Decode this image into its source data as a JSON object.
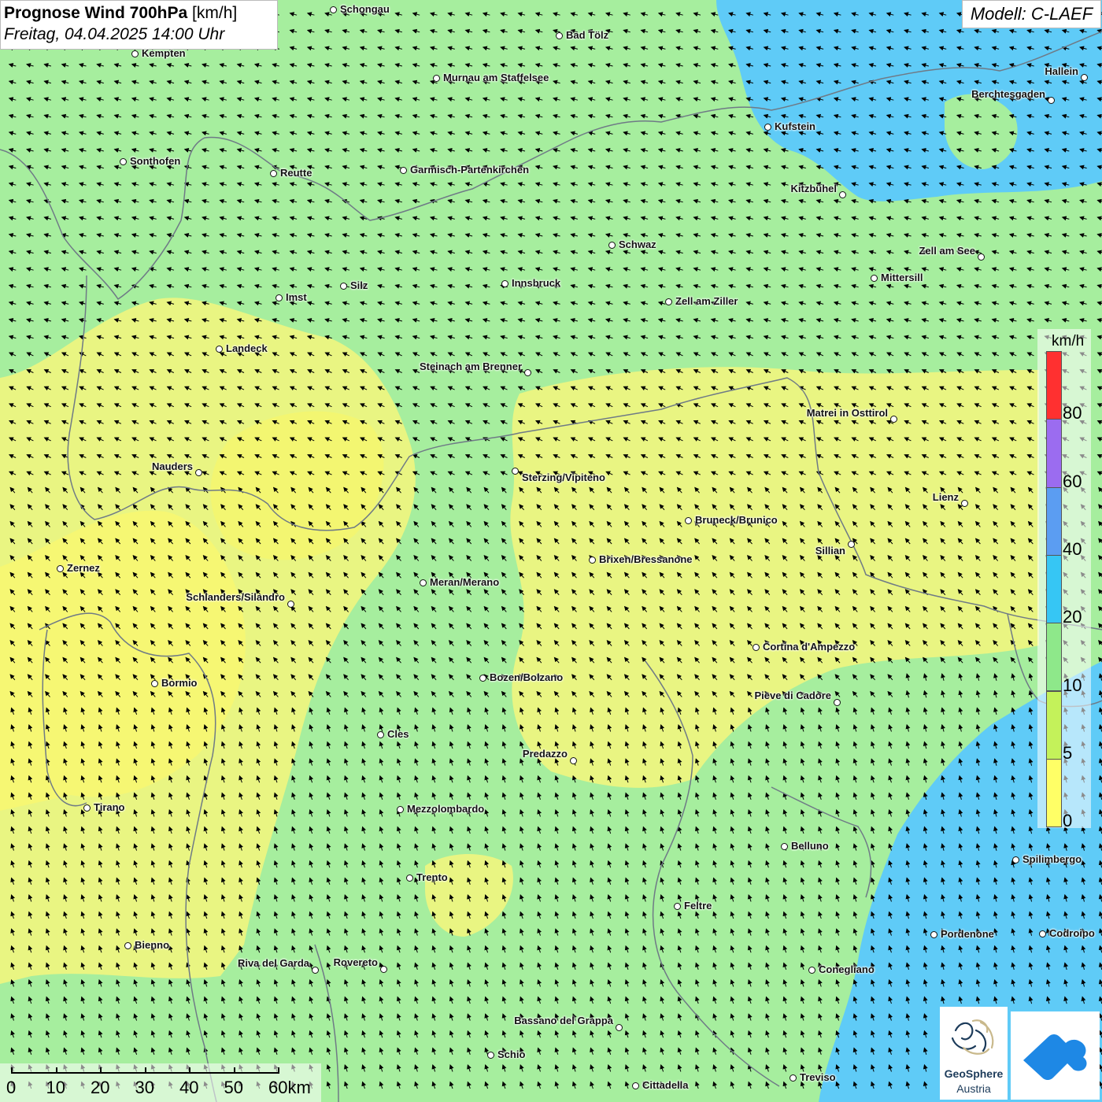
{
  "title": {
    "main": "Prognose Wind 700hPa",
    "unit": "[km/h]",
    "datetime": "Freitag, 04.04.2025 14:00 Uhr"
  },
  "model_label": "Modell: C-LAEF",
  "legend": {
    "unit": "km/h",
    "ticks": [
      "80",
      "60",
      "40",
      "20",
      "10",
      "5",
      "0"
    ],
    "colors": [
      "#ff3030",
      "#9b6cf0",
      "#5b9df2",
      "#36c6f4",
      "#8ee88a",
      "#c4f25a",
      "#ffff66"
    ]
  },
  "scale_bar": {
    "labels": [
      "0",
      "10",
      "20",
      "30",
      "40",
      "50",
      "60km"
    ]
  },
  "logos": {
    "geosphere_line1": "GeoSphere",
    "geosphere_line2": "Austria"
  },
  "colors": {
    "green": "#a6ee9e",
    "yellow": "#ecf582",
    "light_yellow": "#f6f773",
    "blue": "#5fcbf7",
    "border": "#6f7a86"
  },
  "cities": [
    {
      "name": "Schongau"
    },
    {
      "name": "Bad Tölz"
    },
    {
      "name": "Kempten"
    },
    {
      "name": "Murnau am Staffelsee"
    },
    {
      "name": "Hallein"
    },
    {
      "name": "Berchtesgaden"
    },
    {
      "name": "Kufstein"
    },
    {
      "name": "Sonthofen"
    },
    {
      "name": "Reutte"
    },
    {
      "name": "Garmisch-Partenkirchen"
    },
    {
      "name": "Kitzbühel"
    },
    {
      "name": "Schwaz"
    },
    {
      "name": "Zell am See"
    },
    {
      "name": "Mittersill"
    },
    {
      "name": "Imst"
    },
    {
      "name": "Silz"
    },
    {
      "name": "Innsbruck"
    },
    {
      "name": "Zell am Ziller"
    },
    {
      "name": "Landeck"
    },
    {
      "name": "Steinach am Brenner"
    },
    {
      "name": "Matrei in Osttirol"
    },
    {
      "name": "Nauders"
    },
    {
      "name": "Sterzing/Vipiteno"
    },
    {
      "name": "Lienz"
    },
    {
      "name": "Bruneck/Brunico"
    },
    {
      "name": "Sillian"
    },
    {
      "name": "Zernez"
    },
    {
      "name": "Brixen/Bressanone"
    },
    {
      "name": "Meran/Merano"
    },
    {
      "name": "Schlanders/Silandro"
    },
    {
      "name": "Cortina d'Ampezzo"
    },
    {
      "name": "Bozen/Bolzano"
    },
    {
      "name": "Bormio"
    },
    {
      "name": "Pieve di Cadore"
    },
    {
      "name": "Cles"
    },
    {
      "name": "Predazzo"
    },
    {
      "name": "Tirano"
    },
    {
      "name": "Mezzolombardo"
    },
    {
      "name": "Belluno"
    },
    {
      "name": "Spilimbergo"
    },
    {
      "name": "Trento"
    },
    {
      "name": "Feltre"
    },
    {
      "name": "Pordenone"
    },
    {
      "name": "Codroipo"
    },
    {
      "name": "Bienno"
    },
    {
      "name": "Riva del Garda"
    },
    {
      "name": "Rovereto"
    },
    {
      "name": "Conegliano"
    },
    {
      "name": "Bassano del Grappa"
    },
    {
      "name": "Schio"
    },
    {
      "name": "Treviso"
    },
    {
      "name": "Cittadella"
    }
  ]
}
